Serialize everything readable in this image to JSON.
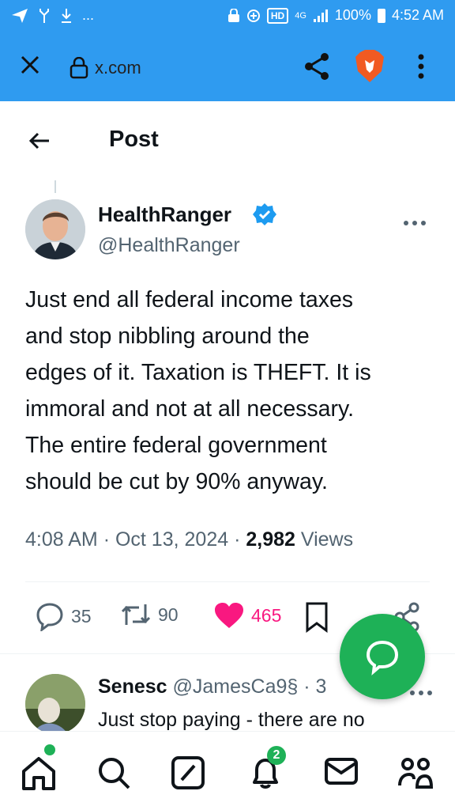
{
  "status_bar": {
    "left_icons": [
      "send-icon",
      "fork-icon",
      "download-icon"
    ],
    "left_ellipsis": "...",
    "hd": "HD",
    "network": "4G",
    "battery": "100%",
    "time": "4:52 AM"
  },
  "browser": {
    "url": "x.com"
  },
  "header": {
    "title": "Post"
  },
  "post": {
    "author_name": "HealthRanger",
    "author_handle": "@HealthRanger",
    "text_lines": [
      "Just end all federal income taxes",
      "and stop nibbling around the",
      "edges of it. Taxation is THEFT. It is",
      "immoral and not at all necessary.",
      "The entire federal government",
      "should be cut by 90% anyway."
    ],
    "time": "4:08 AM",
    "date": "Oct 13, 2024",
    "views_count": "2,982",
    "views_label": "Views",
    "replies": "35",
    "reposts": "90",
    "likes": "465"
  },
  "reply": {
    "name": "Senesc",
    "handle": "@JamesCa9§ · 3",
    "text": "Just stop paying - there are no"
  },
  "bottom_nav": {
    "notifications_badge": "2"
  },
  "colors": {
    "browser_bar": "#2f9bf0",
    "like": "#f91880",
    "fab": "#1eb157",
    "verified": "#1d9bf0",
    "secondary_text": "#536471"
  }
}
